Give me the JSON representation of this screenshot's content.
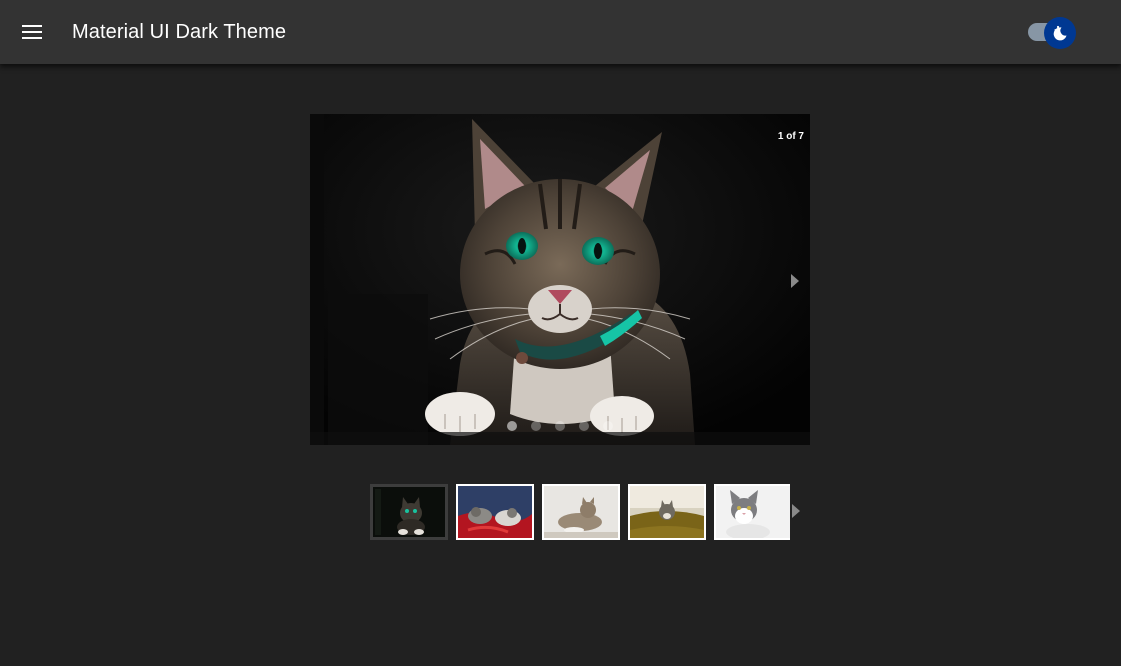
{
  "appbar": {
    "title": "Material UI Dark Theme",
    "menu_icon": "hamburger-menu-icon",
    "theme_toggle": {
      "state": "dark",
      "icon": "moon-icon"
    }
  },
  "carousel": {
    "counter": "1 of 7",
    "current_index": 1,
    "total": 7,
    "dots_visible": 5,
    "next_icon": "chevron-right-icon"
  },
  "thumbnails": [
    {
      "name": "thumb-cat-dark",
      "active": true
    },
    {
      "name": "thumb-cats-red-blanket",
      "active": false
    },
    {
      "name": "thumb-cat-lying",
      "active": false
    },
    {
      "name": "thumb-cat-peeking",
      "active": false
    },
    {
      "name": "thumb-cat-white-grey",
      "active": false
    }
  ],
  "colors": {
    "background": "#212121",
    "appbar": "#333333",
    "switch_track": "#8796a5",
    "switch_thumb": "#003892"
  }
}
